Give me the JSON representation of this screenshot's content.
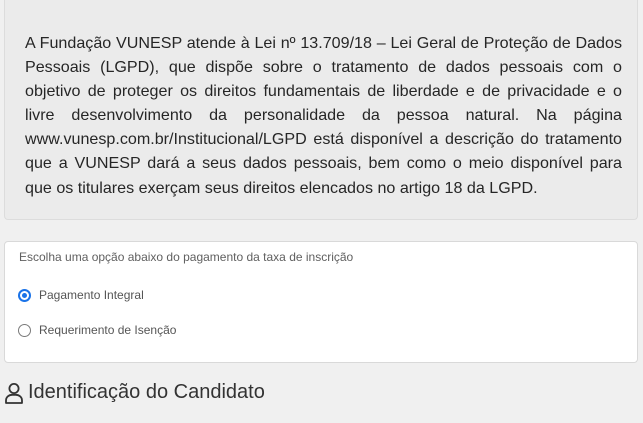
{
  "notice": {
    "text": "A Fundação VUNESP atende à Lei nº 13.709/18 – Lei Geral de Proteção de Dados Pessoais (LGPD), que dispõe sobre o tratamento de dados pessoais com o objetivo de proteger os direitos fundamentais de liberdade e de privacidade e o livre desenvolvimento da personalidade da pessoa natural. Na página www.vunesp.com.br/Institucional/LGPD está disponível a descrição do tratamento que a VUNESP dará a seus dados pessoais, bem como o meio disponível para que os titulares exerçam seus direitos elencados no artigo 18 da LGPD."
  },
  "payment": {
    "heading": "Escolha uma opção abaixo do pagamento da taxa de inscrição",
    "options": [
      {
        "label": "Pagamento Integral",
        "selected": true
      },
      {
        "label": "Requerimento de Isenção",
        "selected": false
      }
    ]
  },
  "section": {
    "icon": "user-icon",
    "title": "Identificação do Candidato"
  },
  "colors": {
    "accent": "#1a73e8",
    "page_background": "#f0f0f0",
    "notice_background": "#ebebeb"
  }
}
